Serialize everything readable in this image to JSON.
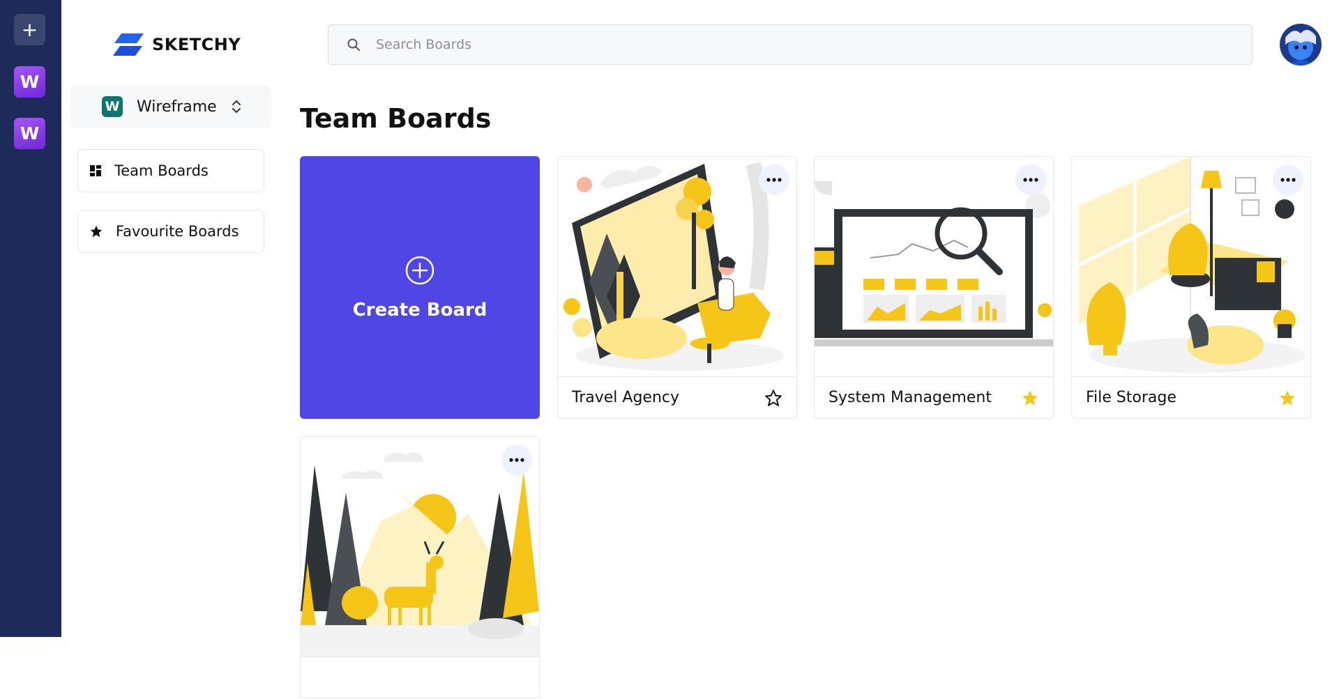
{
  "rail": {
    "add_label": "+",
    "workspaces": [
      {
        "letter": "W"
      },
      {
        "letter": "W"
      }
    ]
  },
  "brand": {
    "name": "SKETCHY",
    "accent": "#2563eb"
  },
  "workspace": {
    "badge": "W",
    "name": "Wireframe"
  },
  "nav": {
    "team_boards": "Team Boards",
    "favourite_boards": "Favourite Boards"
  },
  "search": {
    "placeholder": "Search Boards"
  },
  "page": {
    "title": "Team Boards"
  },
  "create": {
    "label": "Create Board",
    "color": "#4f46e5"
  },
  "boards": [
    {
      "name": "Travel Agency",
      "favourite": false
    },
    {
      "name": "System Management",
      "favourite": true
    },
    {
      "name": "File Storage",
      "favourite": true
    },
    {
      "name": "",
      "favourite": false
    }
  ],
  "colors": {
    "rail": "#1e2a5a",
    "illustration_accent": "#f5c518",
    "star": "#f5c518"
  }
}
